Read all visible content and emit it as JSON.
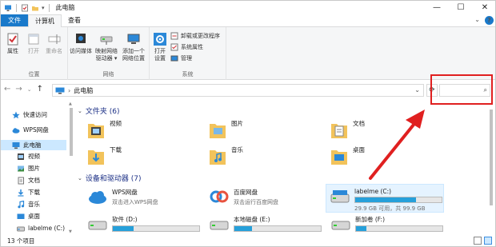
{
  "window": {
    "title": "此电脑",
    "controls": {
      "minimize": "—",
      "maximize": "☐",
      "close": "✕"
    }
  },
  "tabs": [
    {
      "label": "文件"
    },
    {
      "label": "计算机"
    },
    {
      "label": "查看"
    }
  ],
  "ribbon": {
    "location": {
      "group_label": "位置",
      "buttons": [
        {
          "label": "属性",
          "icon": "properties-icon"
        },
        {
          "label": "打开",
          "icon": "open-icon"
        },
        {
          "label": "重命名",
          "icon": "rename-icon"
        }
      ]
    },
    "network": {
      "group_label": "网络",
      "buttons": [
        {
          "label": "访问媒体",
          "icon": "media-icon"
        },
        {
          "label": "映射网络驱动器",
          "line1": "映射网络",
          "line2": "驱动器",
          "icon": "map-drive-icon"
        },
        {
          "label": "添加一个网络位置",
          "line1": "添加一个",
          "line2": "网络位置",
          "icon": "add-network-location-icon"
        }
      ]
    },
    "system": {
      "group_label": "系统",
      "open_settings": {
        "line1": "打开",
        "line2": "设置",
        "icon": "settings-icon"
      },
      "small_buttons": [
        {
          "label": "卸载或更改程序",
          "icon": "uninstall-icon"
        },
        {
          "label": "系统属性",
          "icon": "system-properties-icon"
        },
        {
          "label": "管理",
          "icon": "manage-icon"
        }
      ]
    }
  },
  "address": {
    "crumb": "此电脑",
    "search_placeholder": ""
  },
  "navpane": {
    "items": [
      {
        "label": "快速访问",
        "icon": "star-icon"
      },
      {
        "label": "WPS网盘",
        "icon": "cloud-icon"
      },
      {
        "label": "此电脑",
        "icon": "pc-icon"
      },
      {
        "label": "视频",
        "icon": "video-icon"
      },
      {
        "label": "图片",
        "icon": "pictures-icon"
      },
      {
        "label": "文档",
        "icon": "documents-icon"
      },
      {
        "label": "下载",
        "icon": "download-icon"
      },
      {
        "label": "音乐",
        "icon": "music-icon"
      },
      {
        "label": "桌面",
        "icon": "desktop-icon"
      },
      {
        "label": "labelme (C:)",
        "icon": "drive-icon"
      }
    ]
  },
  "content": {
    "folders_header": "文件夹 (6)",
    "folders": [
      {
        "label": "视频",
        "icon": "video-folder-icon"
      },
      {
        "label": "图片",
        "icon": "pictures-folder-icon"
      },
      {
        "label": "文档",
        "icon": "documents-folder-icon"
      },
      {
        "label": "下载",
        "icon": "downloads-folder-icon"
      },
      {
        "label": "音乐",
        "icon": "music-folder-icon"
      },
      {
        "label": "桌面",
        "icon": "desktop-folder-icon"
      }
    ],
    "drives_header": "设备和驱动器 (7)",
    "drives": [
      {
        "label": "WPS网盘",
        "sub": "双击进入WPS网盘",
        "icon": "wps-cloud-icon",
        "usage": null
      },
      {
        "label": "百度网盘",
        "sub": "双击运行百度网盘",
        "icon": "baidu-cloud-icon",
        "usage": null
      },
      {
        "label": "labelme (C:)",
        "sub": "29.9 GB 可用，共 99.9 GB",
        "icon": "drive-c-icon",
        "usage": 0.7
      },
      {
        "label": "软件 (D:)",
        "sub": "",
        "icon": "drive-d-icon",
        "usage": 0.24
      },
      {
        "label": "本地磁盘 (E:)",
        "sub": "",
        "icon": "drive-e-icon",
        "usage": 0.2
      },
      {
        "label": "新加卷 (F:)",
        "sub": "",
        "icon": "drive-f-icon",
        "usage": 0.12
      }
    ]
  },
  "status": {
    "count": "13 个项目"
  },
  "colors": {
    "accent": "#1979ca",
    "annotation": "#e02020",
    "drive_bar": "#26a0da"
  }
}
